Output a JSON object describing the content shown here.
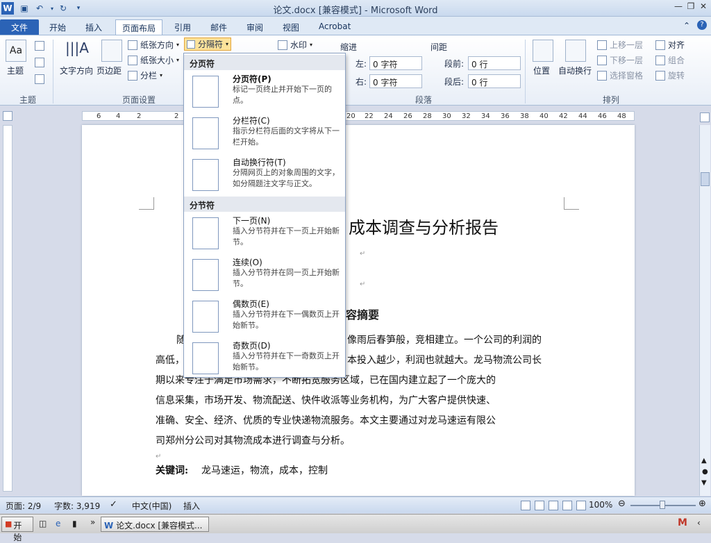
{
  "window": {
    "title": "论文.docx [兼容模式] - Microsoft Word"
  },
  "tabs": [
    "文件",
    "开始",
    "插入",
    "页面布局",
    "引用",
    "邮件",
    "审阅",
    "视图",
    "Acrobat"
  ],
  "ribbon": {
    "theme": {
      "label": "主题",
      "group": "主题"
    },
    "page_setup": {
      "text_direction": "文字方向",
      "margins": "页边距",
      "orientation": "纸张方向",
      "size": "纸张大小",
      "columns": "分栏",
      "breaks": "分隔符",
      "group": "页面设置"
    },
    "watermark": "水印",
    "indent": {
      "title": "缩进",
      "left_label": "左:",
      "left_value": "0 字符",
      "right_label": "右:",
      "right_value": "0 字符"
    },
    "spacing": {
      "title": "间距",
      "before_label": "段前:",
      "before_value": "0 行",
      "after_label": "段后:",
      "after_value": "0 行"
    },
    "paragraph_group": "段落",
    "arrange": {
      "position": "位置",
      "wrap": "自动换行",
      "bring_forward": "上移一层",
      "send_backward": "下移一层",
      "selection_pane": "选择窗格",
      "align": "对齐",
      "group": "组合",
      "rotate": "旋转",
      "group_label": "排列"
    }
  },
  "ruler_ticks": [
    "6",
    "4",
    "2",
    "2",
    "20",
    "22",
    "24",
    "26",
    "28",
    "30",
    "32",
    "34",
    "36",
    "38",
    "40",
    "42",
    "44",
    "46",
    "48"
  ],
  "dropdown": {
    "section1": "分页符",
    "section2": "分节符",
    "items": [
      {
        "title": "分页符(P)",
        "desc": "标记一页终止并开始下一页的点。"
      },
      {
        "title": "分栏符(C)",
        "desc": "指示分栏符后面的文字将从下一栏开始。"
      },
      {
        "title": "自动换行符(T)",
        "desc": "分隔网页上的对象周围的文字，如分隔题注文字与正文。"
      },
      {
        "title": "下一页(N)",
        "desc": "插入分节符并在下一页上开始新节。"
      },
      {
        "title": "连续(O)",
        "desc": "插入分节符并在同一页上开始新节。"
      },
      {
        "title": "偶数页(E)",
        "desc": "插入分节符并在下一偶数页上开始新节。"
      },
      {
        "title": "奇数页(D)",
        "desc": "插入分节符并在下一奇数页上开始新节。"
      }
    ]
  },
  "document": {
    "title": "成本调查与分析报告",
    "heading": "容摘要",
    "line1_a": "随",
    "line1_b": "像雨后春笋般，竞相建立。一个公司的利润的",
    "line2_a": "高低，",
    "line2_b": "本投入越少，利润也就越大。龙马物流公司长",
    "line3": "期以来专注于满足市场需求，不断拓宽服务区域，已在国内建立起了一个庞大的",
    "line4": "信息采集，市场开发、物流配送、快件收派等业务机构，为广大客户提供快速、",
    "line5": "准确、安全、经济、优质的专业快递物流服务。本文主要通过对龙马速运有限公",
    "line6": "司郑州分公司对其物流成本进行调查与分析。",
    "keywords_label": "关键词:",
    "keywords": "龙马速运，物流，成本，控制"
  },
  "status": {
    "page": "页面: 2/9",
    "words": "字数: 3,919",
    "language": "中文(中国)",
    "mode": "插入",
    "zoom": "100%"
  },
  "taskbar": {
    "start": "开始",
    "task": "论文.docx [兼容模式..."
  }
}
